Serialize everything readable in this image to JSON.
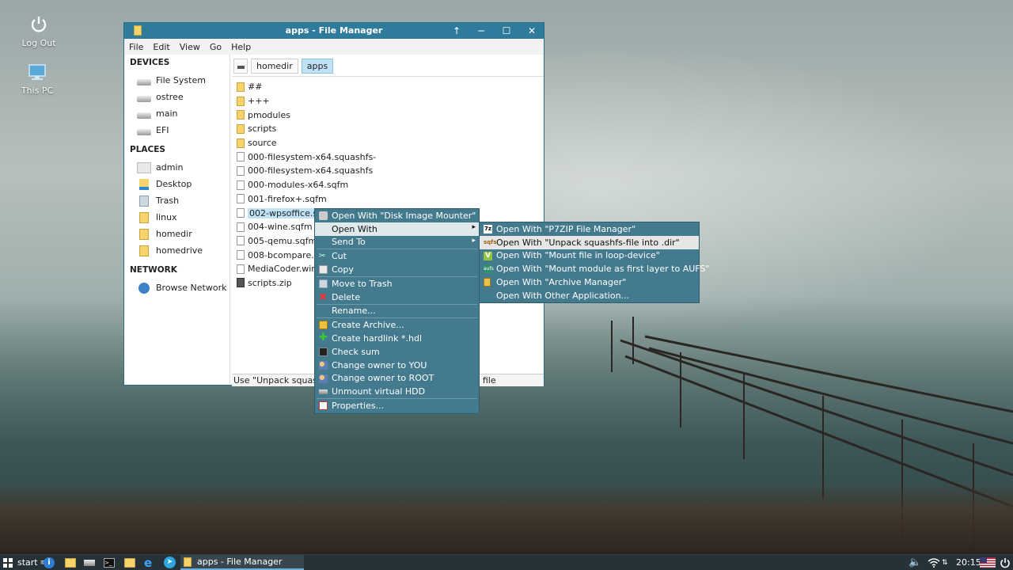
{
  "desktop": {
    "icons": [
      {
        "label": "Log Out",
        "icon": "power-icon"
      },
      {
        "label": "This PC",
        "icon": "computer-icon"
      }
    ]
  },
  "window": {
    "title": "apps - File Manager",
    "menubar": [
      "File",
      "Edit",
      "View",
      "Go",
      "Help"
    ],
    "sidebar": {
      "devices_heading": "DEVICES",
      "devices": [
        "File System",
        "ostree",
        "main",
        "EFI"
      ],
      "places_heading": "PLACES",
      "places": [
        "admin",
        "Desktop",
        "Trash",
        "linux",
        "homedir",
        "homedrive"
      ],
      "network_heading": "NETWORK",
      "network": [
        "Browse Network"
      ]
    },
    "path": [
      "homedir",
      "apps"
    ],
    "files": [
      {
        "name": "##",
        "type": "folder"
      },
      {
        "name": "+++",
        "type": "folder"
      },
      {
        "name": "pmodules",
        "type": "folder"
      },
      {
        "name": "scripts",
        "type": "folder"
      },
      {
        "name": "source",
        "type": "folder"
      },
      {
        "name": "000-filesystem-x64.squashfs-",
        "type": "doc"
      },
      {
        "name": "000-filesystem-x64.squashfs",
        "type": "doc"
      },
      {
        "name": "000-modules-x64.sqfm",
        "type": "doc"
      },
      {
        "name": "001-firefox+.sqfm",
        "type": "doc"
      },
      {
        "name": "002-wpsoffice.sqfm",
        "type": "doc",
        "selected": true
      },
      {
        "name": "004-wine.sqfm",
        "type": "doc"
      },
      {
        "name": "005-qemu.sqfm",
        "type": "doc"
      },
      {
        "name": "008-bcompare.sqfm",
        "type": "doc"
      },
      {
        "name": "MediaCoder.wim",
        "type": "doc"
      },
      {
        "name": "scripts.zip",
        "type": "zip"
      }
    ],
    "status": "Use \"Unpack squashfs-file into .dir\" to open the selected file"
  },
  "context_menu": {
    "items": [
      {
        "label": "Open With \"Disk Image Mounter\"",
        "icon": "disk-icon"
      },
      {
        "label": "Open With",
        "submenu": true,
        "highlight": true
      },
      {
        "label": "Send To",
        "submenu": true
      },
      {
        "sep": true
      },
      {
        "label": "Cut",
        "icon": "scissors-icon"
      },
      {
        "label": "Copy",
        "icon": "copy-icon"
      },
      {
        "sep": true
      },
      {
        "label": "Move to Trash",
        "icon": "trash-icon"
      },
      {
        "label": "Delete",
        "icon": "delete-icon"
      },
      {
        "sep": true
      },
      {
        "label": "Rename..."
      },
      {
        "sep": true
      },
      {
        "label": "Create Archive...",
        "icon": "archive-icon"
      },
      {
        "label": "Create hardlink *.hdl",
        "icon": "plus-icon"
      },
      {
        "label": "Check sum",
        "icon": "terminal-icon"
      },
      {
        "label": "Change owner to YOU",
        "icon": "users-icon"
      },
      {
        "label": "Change owner to ROOT",
        "icon": "users-icon"
      },
      {
        "label": "Unmount virtual HDD",
        "icon": "eject-icon"
      },
      {
        "sep": true
      },
      {
        "label": "Properties...",
        "icon": "properties-icon"
      }
    ]
  },
  "submenu": {
    "items": [
      {
        "label": "Open With \"P7ZIP File Manager\"",
        "icon": "7zip-icon"
      },
      {
        "label": "Open With \"Unpack squashfs-file into .dir\"",
        "icon": "sqfs-icon",
        "highlight": true
      },
      {
        "label": "Open With \"Mount file in loop-device\"",
        "icon": "check-icon"
      },
      {
        "label": "Open With \"Mount module as first layer to AUFS\"",
        "icon": "aufs-icon"
      },
      {
        "label": "Open With \"Archive Manager\"",
        "icon": "archive-manager-icon"
      },
      {
        "label": "Open With Other Application..."
      }
    ]
  },
  "taskbar": {
    "start_label": "start",
    "task_label": "apps - File Manager",
    "clock": "20:15"
  },
  "colors": {
    "titlebar": "#2f7b9c",
    "menu_bg": "#437a8e",
    "taskbar": "#273238",
    "selection": "#bfe2f5"
  }
}
